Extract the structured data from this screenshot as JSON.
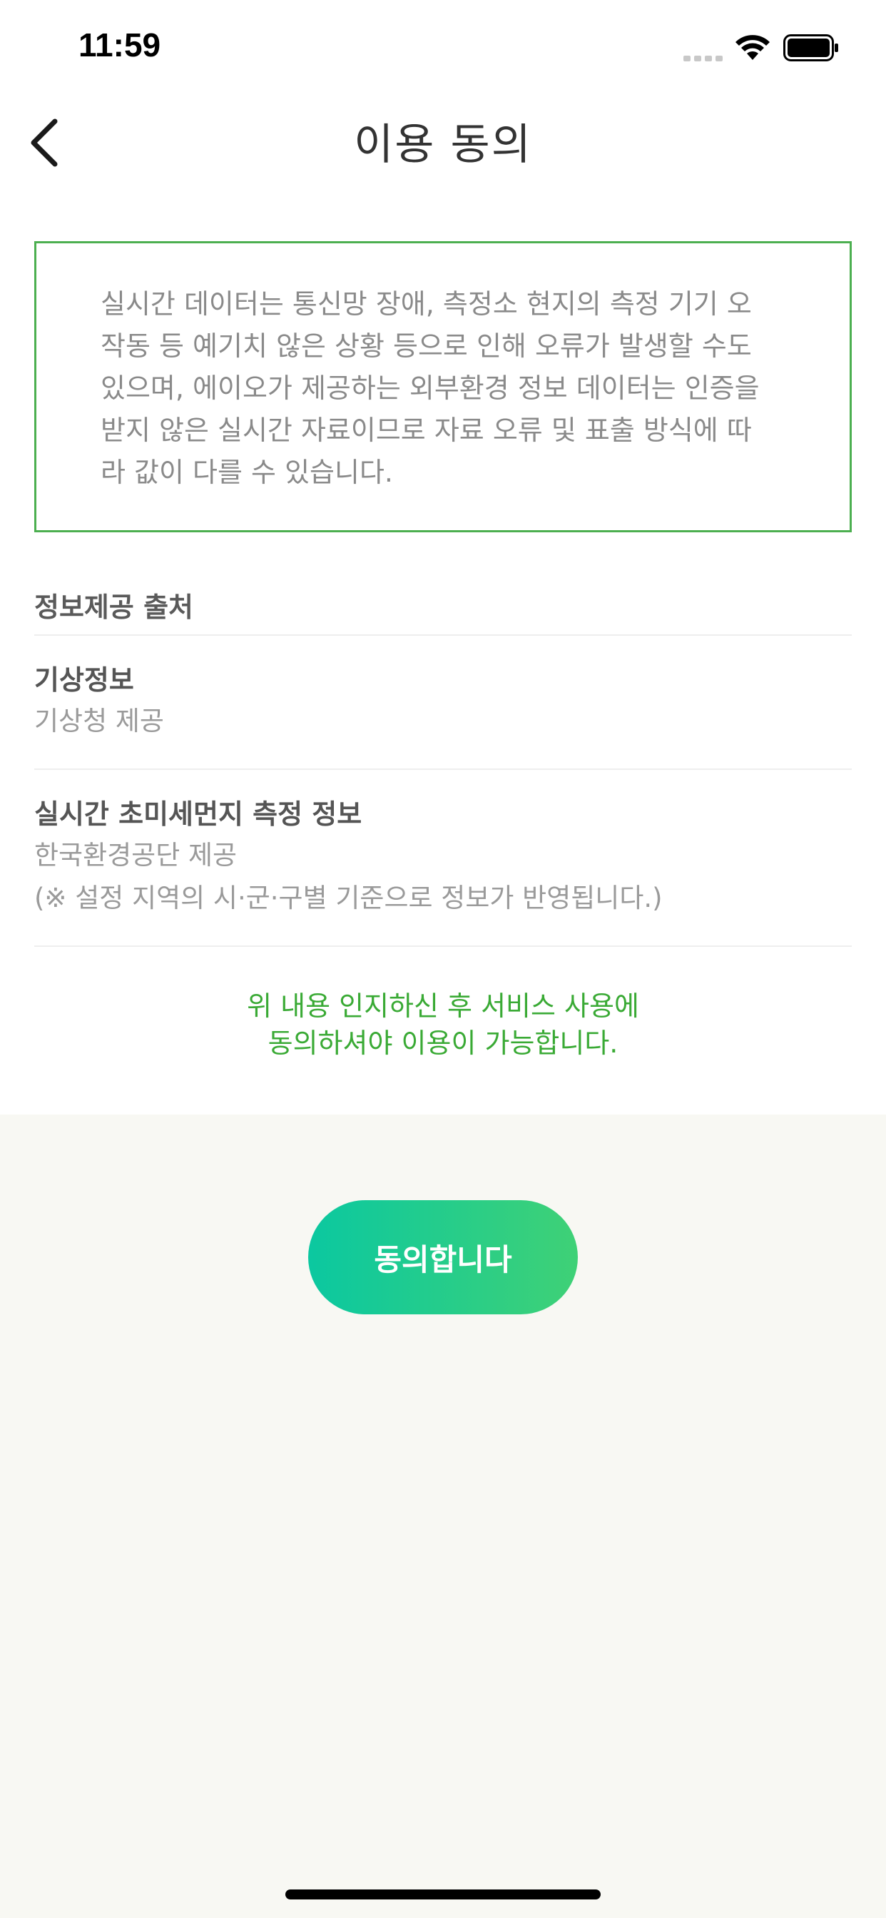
{
  "status_bar": {
    "time": "11:59"
  },
  "header": {
    "title": "이용 동의"
  },
  "notice": {
    "lines": [
      "실시간 데이터는 통신망 장애, 측정소 현지의 측정 기기 오",
      "작동 등 예기치 않은 상황 등으로 인해 오류가 발생할 수도",
      "있으며, 에이오가 제공하는 외부환경 정보 데이터는 인증을",
      "받지 않은 실시간 자료이므로 자료 오류 및 표출 방식에 따",
      "라 값이 다를 수 있습니다."
    ]
  },
  "sources": {
    "heading": "정보제공 출처",
    "items": [
      {
        "title": "기상정보",
        "desc": "기상청 제공",
        "note": ""
      },
      {
        "title": "실시간 초미세먼지 측정 정보",
        "desc": "한국환경공단 제공",
        "note": "(※ 설정 지역의 시·군·구별 기준으로 정보가 반영됩니다.)"
      }
    ]
  },
  "consent": {
    "line1": "위 내용 인지하신 후 서비스 사용에",
    "line2": "동의하셔야 이용이 가능합니다."
  },
  "agree_button": {
    "label": "동의합니다"
  },
  "colors": {
    "accent_green": "#3aaa35",
    "box_border": "#4caf50",
    "button_gradient_start": "#0bc8a0",
    "button_gradient_end": "#3fd176",
    "bottom_panel_bg": "#f8f8f3"
  },
  "icons": {
    "back": "chevron-left-icon",
    "wifi": "wifi-icon",
    "battery": "battery-icon",
    "signal": "signal-dots-icon"
  }
}
